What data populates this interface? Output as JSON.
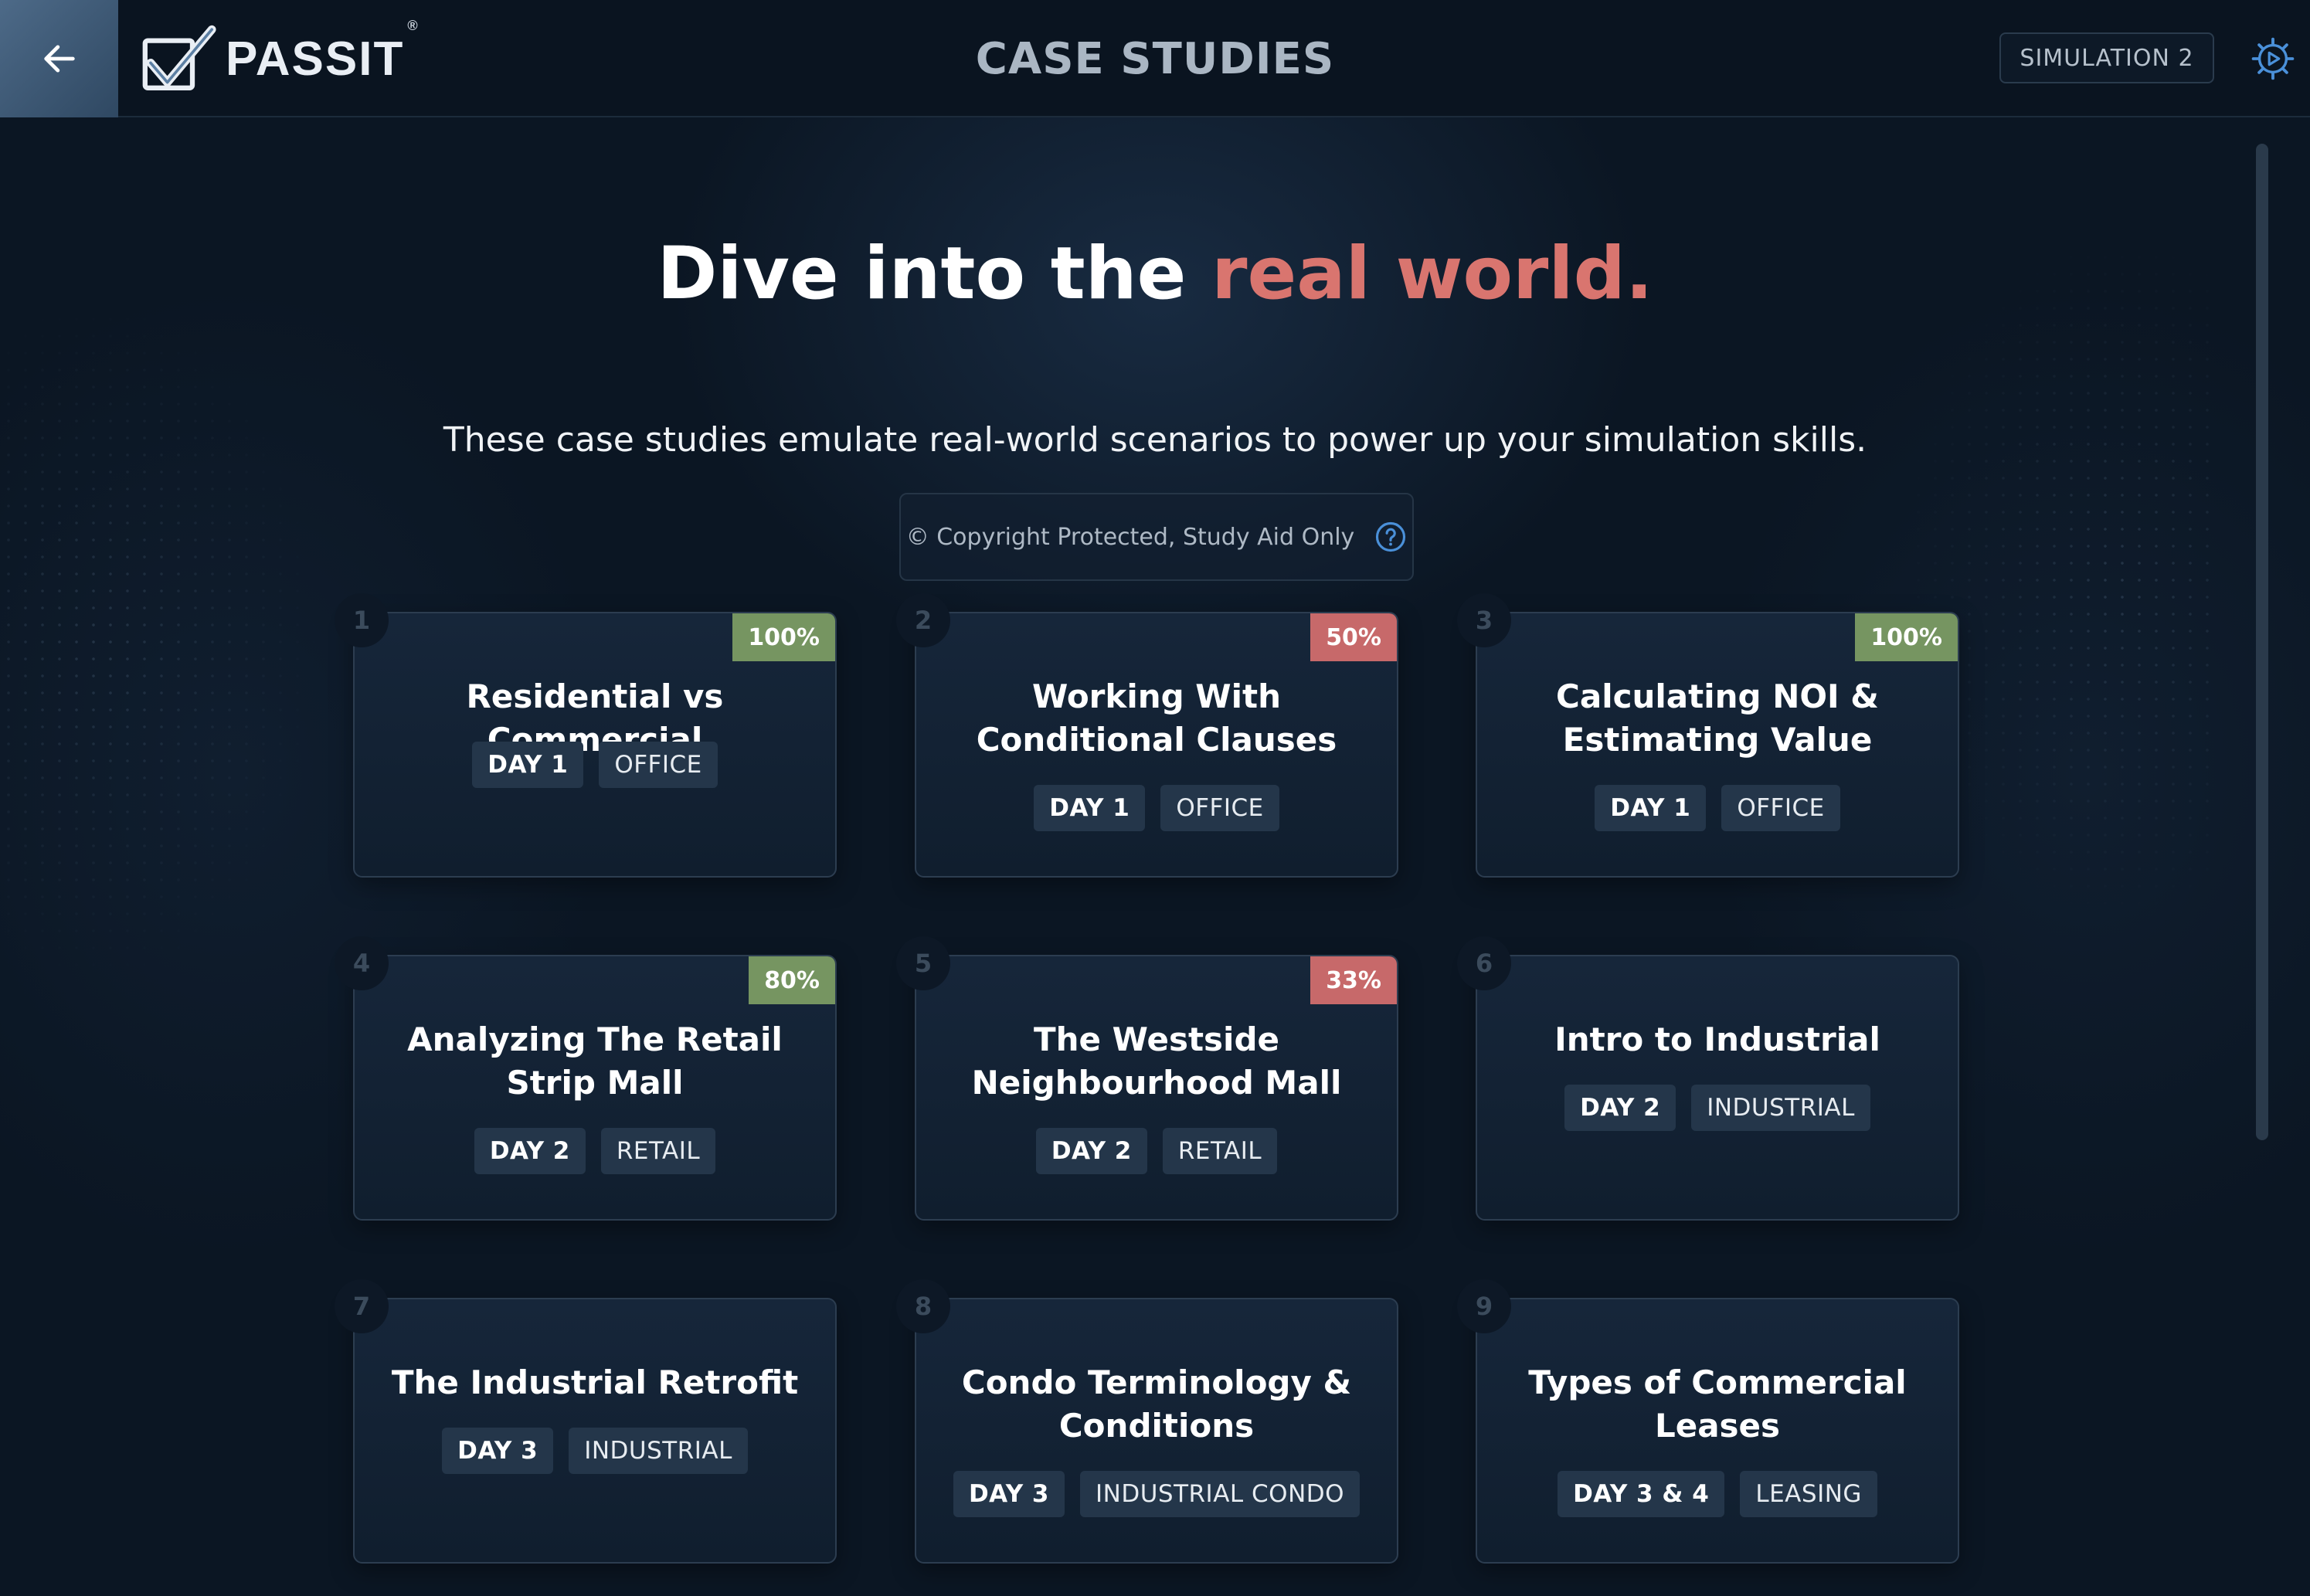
{
  "header": {
    "back_icon": "arrow-left-icon",
    "logo_icon": "checkmark-box-icon",
    "logo_text": "PASSIT",
    "logo_reg": "®",
    "title": "CASE STUDIES",
    "simulation_label": "SIMULATION 2",
    "settings_icon": "gear-play-icon"
  },
  "hero": {
    "title_part1": "Dive into the ",
    "title_accent": "real world.",
    "subtitle": "These case studies emulate real-world scenarios to power up your simulation skills.",
    "copyright": "© Copyright Protected, Study Aid Only",
    "help_icon": "question-circle-icon"
  },
  "colors": {
    "background": "#0b1623",
    "accent": "#d9756f",
    "progress_high": "#769561",
    "progress_low": "#c7696a",
    "tag_bg": "#24364a"
  },
  "cards": [
    {
      "number": "1",
      "title": "Residential vs Commercial",
      "progress": "100%",
      "day": "DAY 1",
      "category": "OFFICE"
    },
    {
      "number": "2",
      "title": "Working With Conditional Clauses",
      "progress": "50%",
      "day": "DAY 1",
      "category": "OFFICE"
    },
    {
      "number": "3",
      "title": "Calculating NOI & Estimating Value",
      "progress": "100%",
      "day": "DAY 1",
      "category": "OFFICE"
    },
    {
      "number": "4",
      "title": "Analyzing The Retail Strip Mall",
      "progress": "80%",
      "day": "DAY 2",
      "category": "RETAIL"
    },
    {
      "number": "5",
      "title": "The Westside Neighbourhood Mall",
      "progress": "33%",
      "day": "DAY 2",
      "category": "RETAIL"
    },
    {
      "number": "6",
      "title": "Intro to Industrial",
      "progress": "",
      "day": "DAY 2",
      "category": "INDUSTRIAL"
    },
    {
      "number": "7",
      "title": "The Industrial Retrofit",
      "progress": "",
      "day": "DAY 3",
      "category": "INDUSTRIAL"
    },
    {
      "number": "8",
      "title": "Condo Terminology & Conditions",
      "progress": "",
      "day": "DAY 3",
      "category": "INDUSTRIAL CONDO"
    },
    {
      "number": "9",
      "title": "Types of Commercial Leases",
      "progress": "",
      "day": "DAY 3 & 4",
      "category": "LEASING"
    }
  ]
}
